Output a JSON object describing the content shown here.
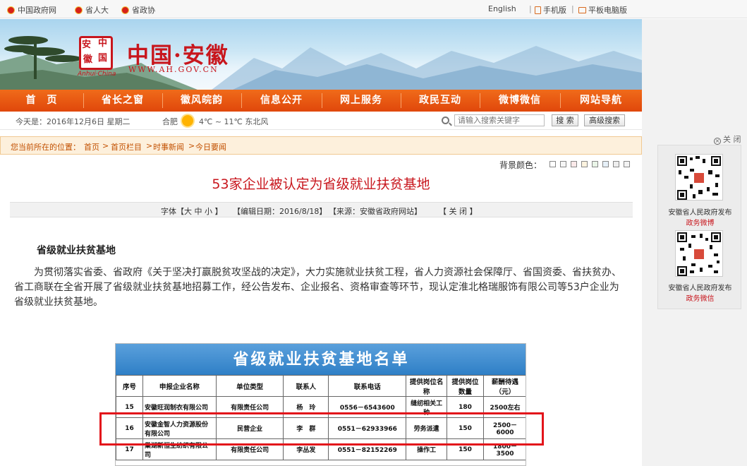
{
  "topbar": {
    "gov_link": "中国政府网",
    "npc_link": "省人大",
    "cppcc_link": "省政协",
    "english": "English",
    "mobile": "手机版",
    "tablet": "平板电脑版"
  },
  "banner": {
    "site_name": "中国·安徽",
    "site_url": "WWW.AH.GOV.CN",
    "seal_chars": [
      "安",
      "中",
      "徽",
      "国"
    ],
    "tagline": "Anhui·China"
  },
  "nav": [
    "首　页",
    "省长之窗",
    "徽风皖韵",
    "信息公开",
    "网上服务",
    "政民互动",
    "微博微信",
    "网站导航"
  ],
  "infobar": {
    "today": "今天是：2016年12月6日 星期二",
    "city": "合肥",
    "weather": "4℃ ~ 11℃ 东北风",
    "search_placeholder": "请输入搜索关键字",
    "search_btn": "搜 索",
    "adv_search_btn": "高级搜索"
  },
  "breadcrumb": {
    "prefix": "您当前所在的位置：",
    "items": [
      "首页",
      "首页栏目",
      "时事新闻",
      "今日要闻"
    ]
  },
  "article": {
    "bg_color_label": "背景颜色：",
    "swatches": [
      "#ffffff",
      "#f6f6f6",
      "#fbe9e9",
      "#fdf3df",
      "#eaf5e8",
      "#e6f0f8",
      "#eeeeee",
      "#f3f3f3"
    ],
    "title": "53家企业被认定为省级就业扶贫基地",
    "font_label": "字体【大 中 小 】",
    "edit_date": "【编辑日期：2016/8/18】",
    "source": "【来源：安徽省政府网站】",
    "close": "【 关 闭 】",
    "subhead": "省级就业扶贫基地",
    "paragraph": "为贯彻落实省委、省政府《关于坚决打赢脱贫攻坚战的决定》，大力实施就业扶贫工程，省人力资源社会保障厅、省国资委、省扶贫办、省工商联在全省开展了省级就业扶贫基地招募工作，经公告发布、企业报名、资格审查等环节，现认定淮北格瑞服饰有限公司等53户企业为省级就业扶贫基地。"
  },
  "table": {
    "title": "省级就业扶贫基地名单",
    "headers": [
      "序号",
      "申报企业名称",
      "单位类型",
      "联系人",
      "联系电话",
      "提供岗位名称",
      "提供岗位数量",
      "薪酬待遇（元）"
    ],
    "rows": [
      [
        "15",
        "安徽旺润制衣有限公司",
        "有限责任公司",
        "杨　玲",
        "0556－6543600",
        "缝纫相关工种",
        "180",
        "2500左右"
      ],
      [
        "16",
        "安徽金智人力资源股份有限公司",
        "民营企业",
        "李　群",
        "0551－62933966",
        "劳务派遣",
        "150",
        "2500－6000"
      ],
      [
        "17",
        "巢湖新恒生纺织有限公司",
        "有限责任公司",
        "李丛发",
        "0551－82152269",
        "操作工",
        "150",
        "1800－3500"
      ]
    ]
  },
  "sidebar": {
    "close": "关 闭",
    "qr1_caption": "安徽省人民政府发布",
    "qr1_sub": "政务微博",
    "qr2_caption": "安徽省人民政府发布",
    "qr2_sub": "政务微信"
  },
  "colors": {
    "brand_red": "#c8161d",
    "nav_orange": "#e0470b",
    "highlight": "#e3141b"
  }
}
